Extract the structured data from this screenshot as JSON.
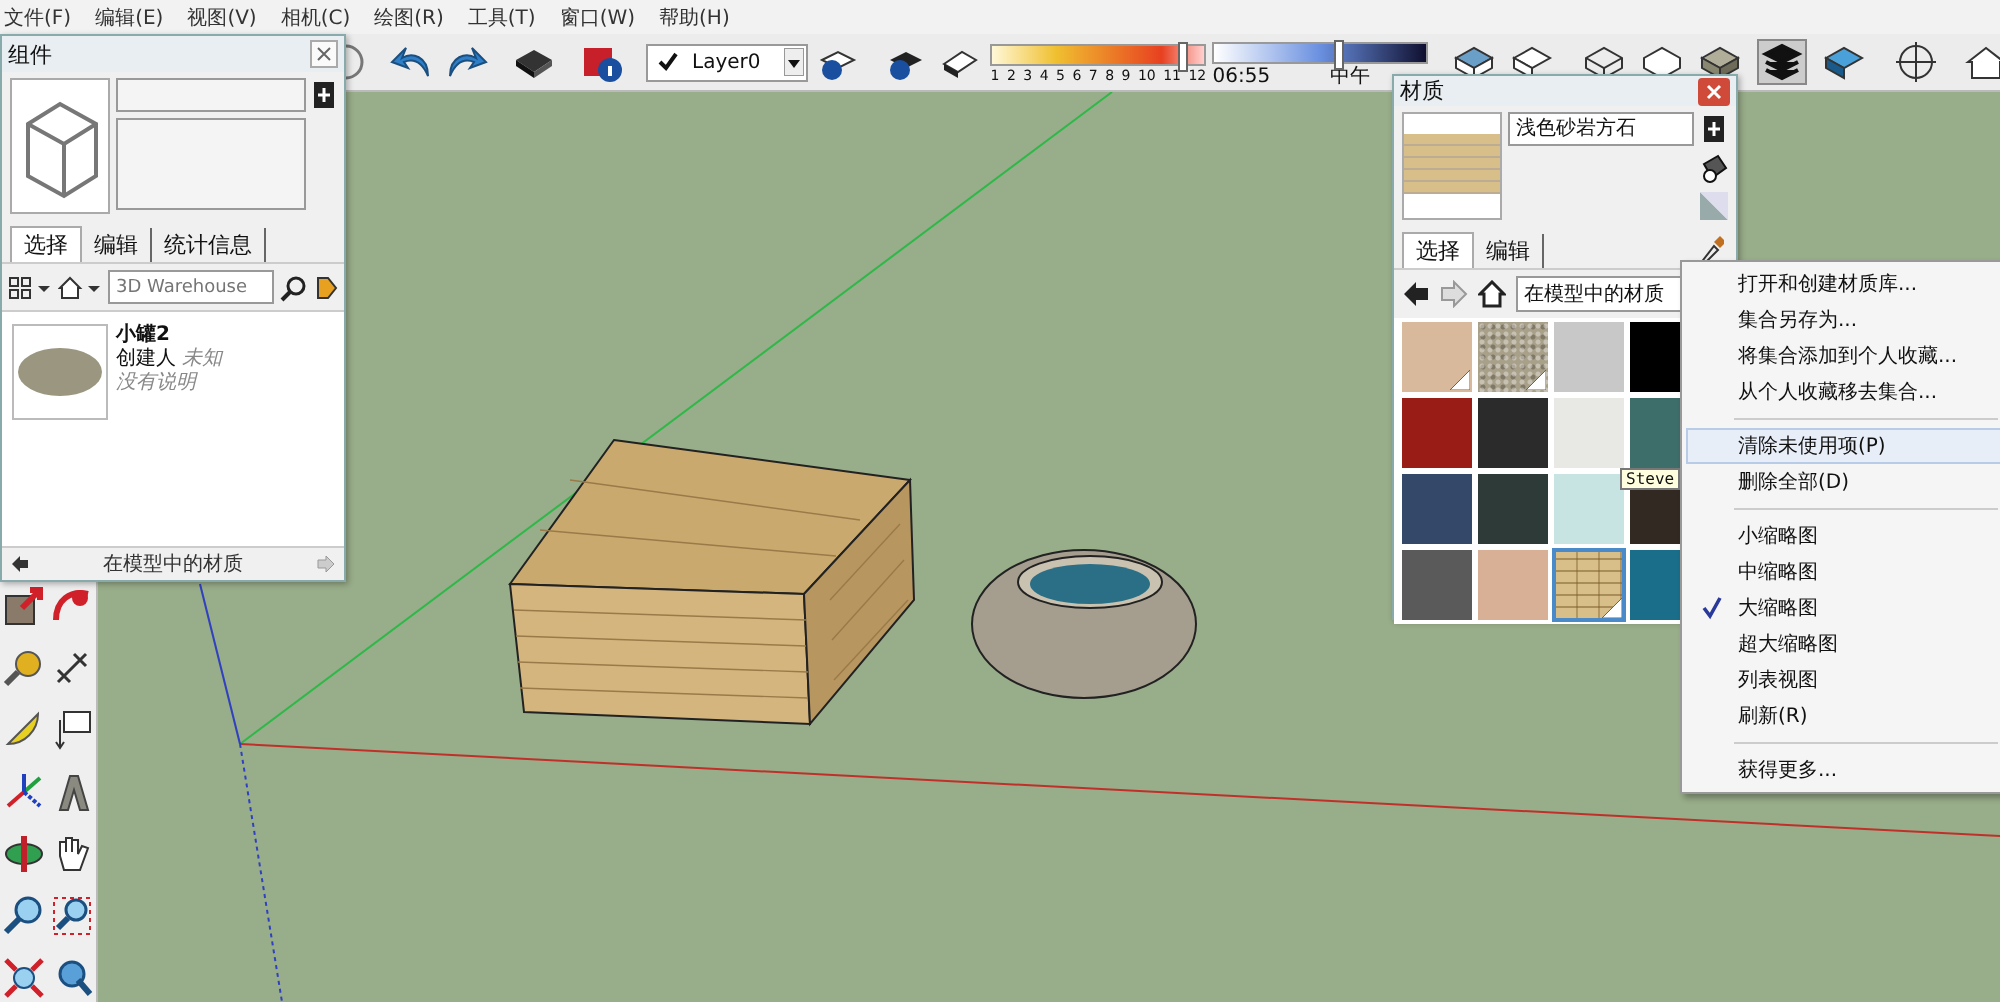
{
  "menu_bar": [
    "文件(F)",
    "编辑(E)",
    "视图(V)",
    "相机(C)",
    "绘图(R)",
    "工具(T)",
    "窗口(W)",
    "帮助(H)"
  ],
  "toolbar": {
    "layer": {
      "visible": true,
      "name": "Layer0"
    },
    "shadow_months": {
      "labels": [
        "1",
        "2",
        "3",
        "4",
        "5",
        "6",
        "7",
        "8",
        "9",
        "10",
        "11",
        "12"
      ],
      "level": 0.88
    },
    "shadow_time": {
      "start": "06:55",
      "noon": "中午",
      "level": 0.57
    }
  },
  "components_panel": {
    "title": "组件",
    "tabs": [
      {
        "label": "选择",
        "selected": true
      },
      {
        "label": "编辑",
        "selected": false
      },
      {
        "label": "统计信息",
        "selected": false
      }
    ],
    "search": {
      "placeholder": "3D Warehouse"
    },
    "items": [
      {
        "name": "小罐2",
        "creator_label": "创建人",
        "creator": "未知",
        "description": "没有说明"
      }
    ],
    "footer": "在模型中的材质"
  },
  "materials_panel": {
    "title": "材质",
    "name": "浅色砂岩方石",
    "tabs": [
      {
        "label": "选择",
        "selected": true
      },
      {
        "label": "编辑",
        "selected": false
      }
    ],
    "collection": "在模型中的材质",
    "swatches": [
      {
        "kind": "plain",
        "color": "#d9b99b",
        "in_use": true,
        "selected": false
      },
      {
        "kind": "speckled",
        "color": "#a9a08a",
        "in_use": true,
        "selected": false
      },
      {
        "kind": "plain",
        "color": "#c8c8c8",
        "in_use": false,
        "selected": false
      },
      {
        "kind": "plain",
        "color": "#000000",
        "in_use": false,
        "selected": false
      },
      {
        "kind": "plain",
        "color": "#9a1c17",
        "in_use": false,
        "selected": false
      },
      {
        "kind": "plain",
        "color": "#2b2b2b",
        "in_use": false,
        "selected": false
      },
      {
        "kind": "plain",
        "color": "#e8e8e4",
        "in_use": false,
        "selected": false
      },
      {
        "kind": "plain",
        "color": "#3e6e6a",
        "in_use": false,
        "selected": false
      },
      {
        "kind": "plain",
        "color": "#34496a",
        "in_use": false,
        "selected": false
      },
      {
        "kind": "plain",
        "color": "#2d3a38",
        "in_use": false,
        "selected": false
      },
      {
        "kind": "plain",
        "color": "#c7e4e2",
        "in_use": false,
        "selected": false
      },
      {
        "kind": "plain",
        "color": "#322a22",
        "in_use": false,
        "selected": false
      },
      {
        "kind": "plain",
        "color": "#5a5a5a",
        "in_use": false,
        "selected": false
      },
      {
        "kind": "plain",
        "color": "#d8b095",
        "in_use": false,
        "selected": false
      },
      {
        "kind": "brick",
        "color": "#d8bf8a",
        "in_use": true,
        "selected": true
      },
      {
        "kind": "plain",
        "color": "#1a6e8a",
        "in_use": false,
        "selected": false
      }
    ],
    "tooltip": "Steve"
  },
  "context_menu": {
    "groups": [
      {
        "items": [
          {
            "label": "打开和创建材质库...",
            "highlighted": false,
            "checked": false
          },
          {
            "label": "集合另存为...",
            "highlighted": false,
            "checked": false
          },
          {
            "label": "将集合添加到个人收藏...",
            "highlighted": false,
            "checked": false
          },
          {
            "label": "从个人收藏移去集合...",
            "highlighted": false,
            "checked": false
          }
        ]
      },
      {
        "items": [
          {
            "label": "清除未使用项(P)",
            "highlighted": true,
            "checked": false
          },
          {
            "label": "删除全部(D)",
            "highlighted": false,
            "checked": false
          }
        ]
      },
      {
        "items": [
          {
            "label": "小缩略图",
            "highlighted": false,
            "checked": false
          },
          {
            "label": "中缩略图",
            "highlighted": false,
            "checked": false
          },
          {
            "label": "大缩略图",
            "highlighted": false,
            "checked": true
          },
          {
            "label": "超大缩略图",
            "highlighted": false,
            "checked": false
          },
          {
            "label": "列表视图",
            "highlighted": false,
            "checked": false
          },
          {
            "label": "刷新(R)",
            "highlighted": false,
            "checked": false
          }
        ]
      },
      {
        "items": [
          {
            "label": "获得更多...",
            "highlighted": false,
            "checked": false
          }
        ]
      }
    ]
  }
}
